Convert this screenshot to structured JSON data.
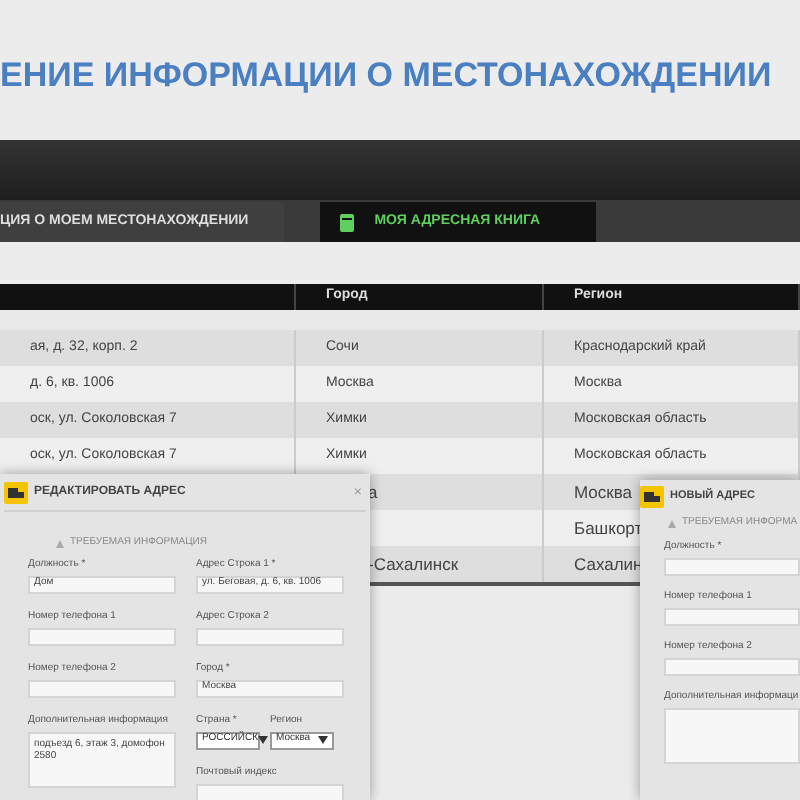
{
  "title": "ЕНИЕ ИНФОРМАЦИИ О МЕСТОНАХОЖДЕНИИ",
  "tabs": [
    {
      "label": "ЦИЯ О МОЕМ МЕСТОНАХОЖДЕНИИ",
      "selected": false
    },
    {
      "label": "МОЯ АДРЕСНАЯ КНИГА",
      "selected": true
    }
  ],
  "table": {
    "columns": [
      "",
      "Город",
      "Регион"
    ],
    "rows": [
      {
        "cells": [
          "ая, д. 32, корп. 2",
          "Сочи",
          "Краснодарский край"
        ]
      },
      {
        "cells": [
          "д. 6, кв. 1006",
          "Москва",
          "Москва"
        ]
      },
      {
        "cells": [
          "оск, ул. Соколовская 7",
          "Химки",
          "Московская область"
        ]
      },
      {
        "cells": [
          "оск, ул. Соколовская 7",
          "Химки",
          "Московская область"
        ]
      },
      {
        "cells": [
          "",
          "а",
          "Москва"
        ]
      },
      {
        "cells": [
          "",
          "",
          "Башкорт"
        ]
      },
      {
        "cells": [
          "",
          "-Сахалинск",
          "Сахалин"
        ]
      }
    ]
  },
  "edit_dialog": {
    "title": "РЕДАКТИРОВАТЬ АДРЕС",
    "close": "×",
    "section": "ТРЕБУЕМАЯ ИНФОРМАЦИЯ",
    "left_column": [
      {
        "kind": "text",
        "label": "Должность *",
        "value": "Дом"
      },
      {
        "kind": "text",
        "label": "Номер телефона 1"
      },
      {
        "kind": "text",
        "label": "Номер телефона 2"
      },
      {
        "kind": "textarea",
        "label": "Дополнительная информация",
        "value": "подъезд 6, этаж 3, домофон 2580"
      }
    ],
    "right_column": [
      {
        "kind": "text",
        "label": "Адрес Строка 1 *",
        "value": "ул. Беговая, д. 6, кв. 1006"
      },
      {
        "kind": "text",
        "label": "Адрес Строка 2"
      },
      {
        "kind": "text",
        "label": "Город *",
        "value": "Москва"
      },
      {
        "kind": "select",
        "label": "Страна *",
        "value": "РОССИЙСК"
      },
      {
        "kind": "select",
        "label": "Регион",
        "value": "Москва"
      },
      {
        "kind": "text",
        "label": "Почтовый индекс"
      }
    ]
  },
  "new_dialog": {
    "title": "НОВЫЙ АДРЕС",
    "section": "ТРЕБУЕМАЯ ИНФОРМА",
    "fields": [
      {
        "kind": "text",
        "label": "Должность *"
      },
      {
        "kind": "text",
        "label": "Номер телефона 1"
      },
      {
        "kind": "text",
        "label": "Номер телефона 2"
      },
      {
        "kind": "textarea",
        "label": "Дополнительная информаци"
      }
    ]
  }
}
